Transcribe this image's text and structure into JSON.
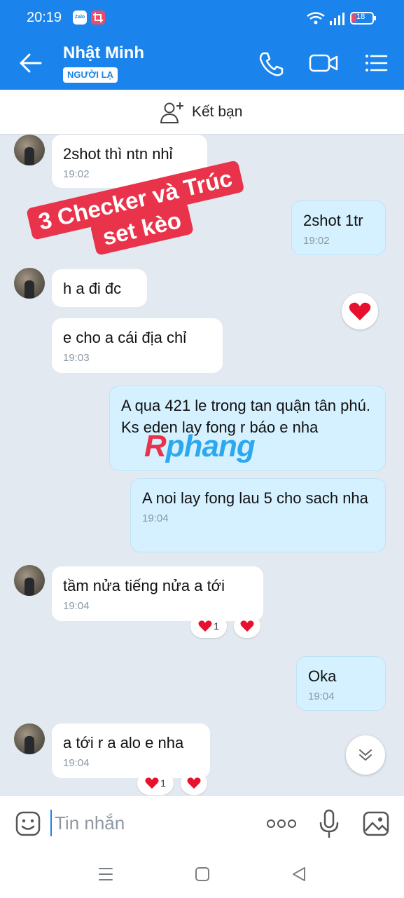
{
  "status_bar": {
    "time": "20:19",
    "app_icon_1": "Zalo",
    "battery": "18"
  },
  "header": {
    "contact_name": "Nhật Minh",
    "badge": "NGƯỜI LẠ"
  },
  "friend_bar": {
    "label": "Kết bạn"
  },
  "sticker": {
    "line1": "3 Checker và Trúc",
    "line2": "set kèo"
  },
  "watermark": {
    "letter": "R",
    "rest": "phang"
  },
  "messages": [
    {
      "direction": "in",
      "text": "2shot thì ntn nhỉ",
      "time": "19:02"
    },
    {
      "direction": "out",
      "text": "2shot 1tr",
      "time": "19:02"
    },
    {
      "direction": "in",
      "text": "h a đi đc",
      "time": ""
    },
    {
      "direction": "in",
      "text": "e cho a cái địa chỉ",
      "time": "19:03"
    },
    {
      "direction": "out",
      "text": "A qua 421 le trong tan quận tân phú. Ks eden lay fong r báo e nha",
      "time": ""
    },
    {
      "direction": "out",
      "text": "A noi lay fong lau 5 cho sach nha",
      "time": "19:04"
    },
    {
      "direction": "in",
      "text": "tầm nửa tiếng nửa a tới",
      "time": "19:04"
    },
    {
      "direction": "out",
      "text": "Oka",
      "time": "19:04"
    },
    {
      "direction": "in",
      "text": "a tới r a alo e nha",
      "time": "19:04"
    }
  ],
  "reactions": {
    "msg7_count": "1",
    "msg9_count": "1"
  },
  "input": {
    "placeholder": "Tin nhắn"
  },
  "colors": {
    "accent": "#1a84ec",
    "outgoing_bubble": "#d5f1ff",
    "heart": "#e8112d",
    "sticker": "#e8334a"
  }
}
